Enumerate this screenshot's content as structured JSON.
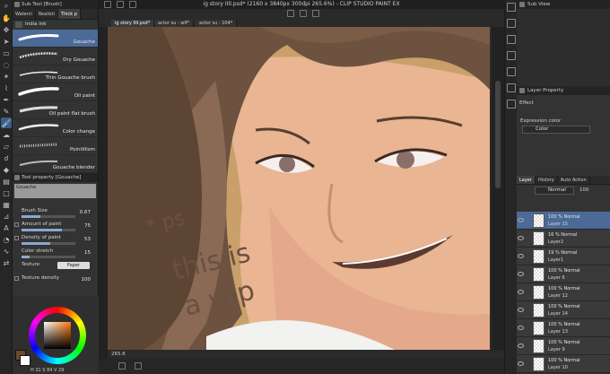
{
  "app": {
    "window_title": "ig story IIIl.psd* (2160 x 3840px 300dpi 265.6%)  - CLIP STUDIO PAINT EX",
    "doc_tabs": [
      "ig story IIIl.psd*",
      "actor su - wlf*",
      "actor su - 104*"
    ],
    "zoom_status": "265.6"
  },
  "subtool_panel": {
    "title": "Sub Tool [Brush]",
    "tabs": [
      "Watercl",
      "Realisti",
      "Thick p"
    ],
    "ink_label": "India ink",
    "brushes": [
      {
        "name": "Gouache",
        "selected": true
      },
      {
        "name": "Dry Gouache",
        "selected": false
      },
      {
        "name": "Thin Gouache brush",
        "selected": false
      },
      {
        "name": "Oil paint",
        "selected": false
      },
      {
        "name": "Oil paint flat brush",
        "selected": false
      },
      {
        "name": "Color change",
        "selected": false
      },
      {
        "name": "Pointillism",
        "selected": false
      },
      {
        "name": "Gouache blender",
        "selected": false
      }
    ]
  },
  "tool_property": {
    "title": "Tool property [Gouache]",
    "preset_name": "Gouache",
    "props": [
      {
        "label": "Brush Size",
        "value": "0.67",
        "fill": 0.35
      },
      {
        "label": "Amount of paint",
        "value": "75",
        "fill": 0.75
      },
      {
        "label": "Density of paint",
        "value": "53",
        "fill": 0.53
      },
      {
        "label": "Color stretch",
        "value": "15",
        "fill": 0.15
      }
    ],
    "texture_label": "Texture",
    "texture_value": "Paper",
    "texture_density_label": "Texture density",
    "texture_density_value": "100"
  },
  "color": {
    "hsv": "H 31  S 84  V 29",
    "main_color": "#6b4a2a",
    "sub_color": "#ffffff"
  },
  "canvas": {
    "annotation_lines": [
      "* ps",
      "this is",
      "a wip"
    ]
  },
  "sub_view": {
    "title": "Sub View"
  },
  "layer_property": {
    "title": "Layer Property",
    "effect_label": "Effect",
    "expression_color_label": "Expression color",
    "expression_color_value": "Color"
  },
  "layer_panel": {
    "tabs": [
      "Layer",
      "History",
      "Auto Action"
    ],
    "blend_mode": "Normal",
    "opacity": "100",
    "layers": [
      {
        "line1": "100 % Normal",
        "line2": "Layer 15",
        "selected": true
      },
      {
        "line1": "16 % Normal",
        "line2": "Layer2",
        "selected": false
      },
      {
        "line1": "19 % Normal",
        "line2": "Layer1",
        "selected": false
      },
      {
        "line1": "100 % Normal",
        "line2": "Layer 6",
        "selected": false
      },
      {
        "line1": "100 % Normal",
        "line2": "Layer 12",
        "selected": false
      },
      {
        "line1": "100 % Normal",
        "line2": "Layer 14",
        "selected": false
      },
      {
        "line1": "100 % Normal",
        "line2": "Layer 13",
        "selected": false
      },
      {
        "line1": "100 % Normal",
        "line2": "Layer 9",
        "selected": false
      },
      {
        "line1": "100 % Normal",
        "line2": "Layer 10",
        "selected": false
      }
    ]
  }
}
